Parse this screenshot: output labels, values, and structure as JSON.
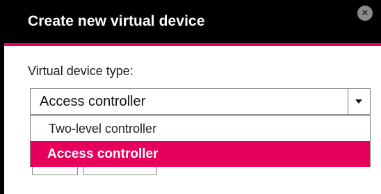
{
  "dialog": {
    "title": "Create new virtual device",
    "close_icon": "close-icon"
  },
  "form": {
    "device_type_label": "Virtual device type:",
    "device_type_select": {
      "selected": "Access controller",
      "options": [
        {
          "label": "Two-level controller",
          "highlighted": false
        },
        {
          "label": "Access controller",
          "highlighted": true
        }
      ]
    }
  },
  "colors": {
    "titlebar": "#000000",
    "accent": "#e6005c",
    "title_text": "#ffffff"
  }
}
